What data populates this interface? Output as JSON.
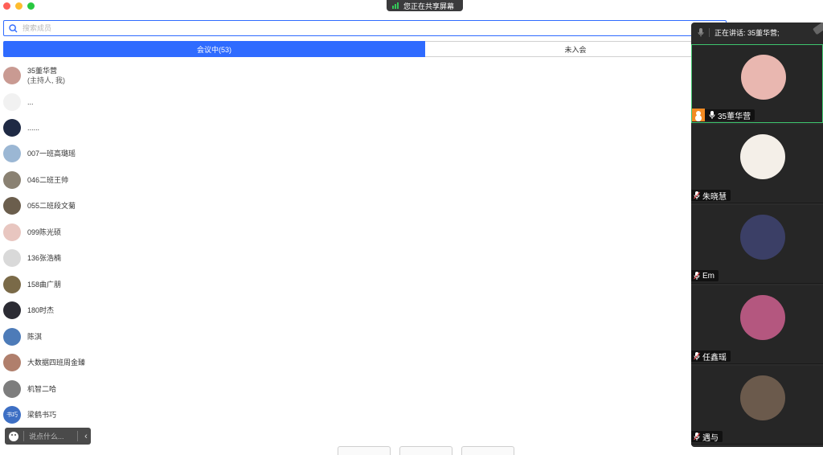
{
  "window": {
    "controls": [
      "close",
      "minimize",
      "zoom"
    ]
  },
  "share_banner": {
    "text": "您正在共享屏幕",
    "icon": "signal-bars-icon"
  },
  "search": {
    "placeholder": "搜索成员",
    "icon": "search-icon"
  },
  "tabs": [
    {
      "label": "会议中(53)",
      "active": true
    },
    {
      "label": "未入会",
      "active": false
    }
  ],
  "participants": [
    {
      "name": "35董华营",
      "sub": "(主持人, 我)",
      "avatar_color": "#c99a92"
    },
    {
      "name": "...",
      "avatar_color": "#f1f1f1"
    },
    {
      "name": "......",
      "avatar_color": "#1f2a44"
    },
    {
      "name": "007一班高璐瑶",
      "avatar_color": "#9bb7d4"
    },
    {
      "name": "046二班王帅",
      "avatar_color": "#8a8172"
    },
    {
      "name": "055二班段文菊",
      "avatar_color": "#6b5e4d"
    },
    {
      "name": "099陈光硕",
      "avatar_color": "#e8c6c0"
    },
    {
      "name": "136张浩楠",
      "avatar_color": "#d9d9d9"
    },
    {
      "name": "158曲广朋",
      "avatar_color": "#7a6a48"
    },
    {
      "name": "180时杰",
      "avatar_color": "#2b2b33"
    },
    {
      "name": "陈淇",
      "avatar_color": "#4d7bb8"
    },
    {
      "name": "大数据四班周金臻",
      "avatar_color": "#b07f6c"
    },
    {
      "name": "机智二哈",
      "avatar_color": "#7d7d7d"
    },
    {
      "name": "梁鹤书巧",
      "avatar_text": "书巧",
      "avatar_color": "#3d6fc4"
    }
  ],
  "chat_bar": {
    "placeholder": "说点什么...",
    "emoji_icon": "emoji-icon",
    "collapse_icon": "chevron-left-icon"
  },
  "video_panel": {
    "speaking_label": "正在讲话: 35董华营;",
    "tiles": [
      {
        "name": "35董华营",
        "host": true,
        "mic": "on",
        "active": true,
        "avatar_color": "#e9b7b0"
      },
      {
        "name": "朱晓慧",
        "mic": "muted",
        "avatar_color": "#f4efe8"
      },
      {
        "name": "Em",
        "mic": "muted",
        "avatar_color": "#3b3f66"
      },
      {
        "name": "任鑫瑶",
        "mic": "muted",
        "avatar_color": "#b4577f"
      },
      {
        "name": "遇与",
        "mic": "muted",
        "avatar_color": "#6b5a4c"
      }
    ]
  }
}
